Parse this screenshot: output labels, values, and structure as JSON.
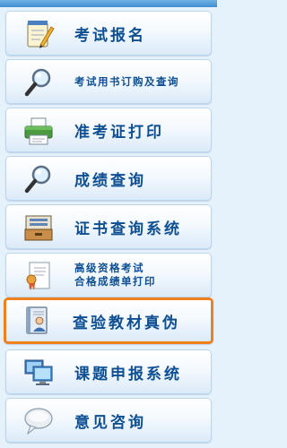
{
  "menu": {
    "items": [
      {
        "label": "考试报名"
      },
      {
        "label": "考试用书订购及查询"
      },
      {
        "label": "准考证打印"
      },
      {
        "label": "成绩查询"
      },
      {
        "label": "证书查询系统"
      },
      {
        "label_line1": "高级资格考试",
        "label_line2": "合格成绩单打印"
      },
      {
        "label": "查验教材真伪"
      },
      {
        "label": "课题申报系统"
      },
      {
        "label": "意见咨询"
      }
    ]
  },
  "colors": {
    "label_text": "#0d4f92",
    "highlight_border": "#f07f1e",
    "page_background": "#e6f2fb"
  },
  "icons": [
    "notepad-pencil-icon",
    "magnifier-icon",
    "printer-icon",
    "magnifier-icon",
    "file-drawer-icon",
    "certificate-ribbon-icon",
    "book-person-icon",
    "monitors-icon",
    "speech-bubble-icon"
  ]
}
